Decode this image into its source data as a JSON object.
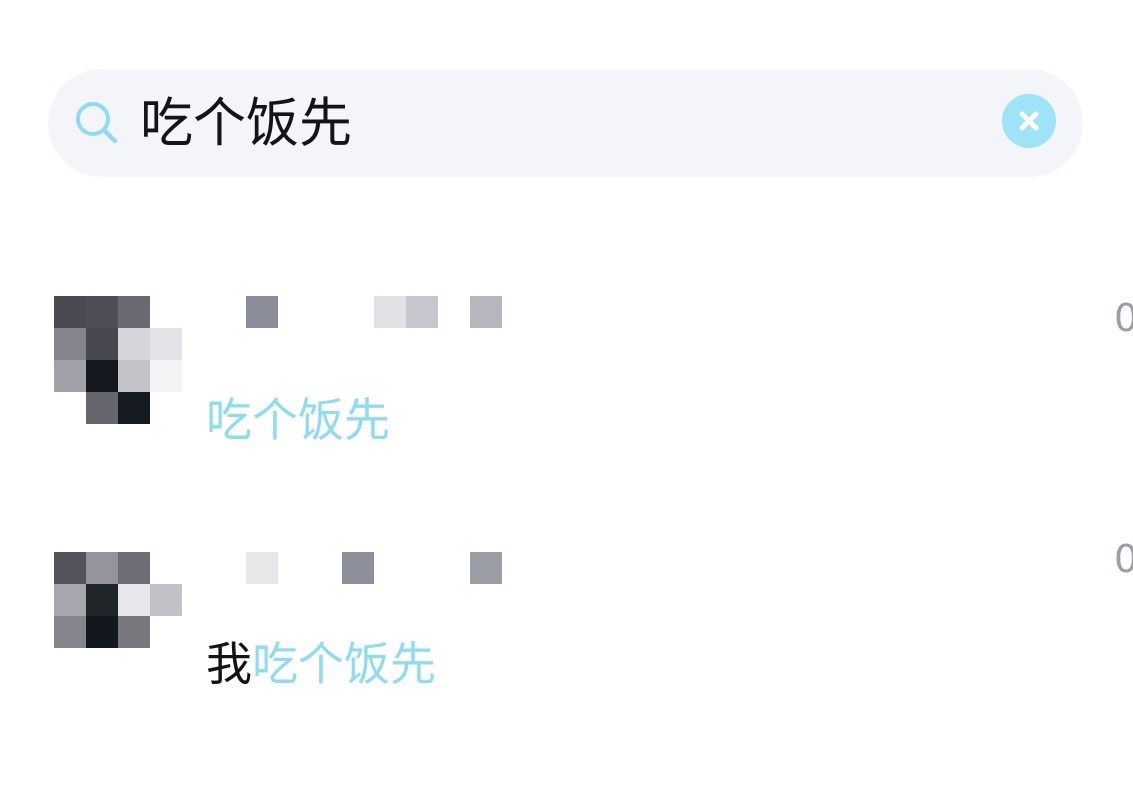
{
  "search": {
    "query": "吃个饭先",
    "icon": "search-icon",
    "clear_icon": "close-icon",
    "accent_color": "#9fe3f7"
  },
  "results": [
    {
      "avatar_blurred": true,
      "name_blurred": true,
      "message_prefix": "",
      "message_highlight": "吃个饭先",
      "time_partial": "0"
    },
    {
      "avatar_blurred": true,
      "name_blurred": true,
      "message_prefix": "我",
      "message_highlight": "吃个饭先",
      "time_partial": "0"
    }
  ],
  "colors": {
    "highlight": "#8fdcf2",
    "text": "#111418",
    "time": "#9a9ea6",
    "search_bg": "#f3f5f8"
  }
}
